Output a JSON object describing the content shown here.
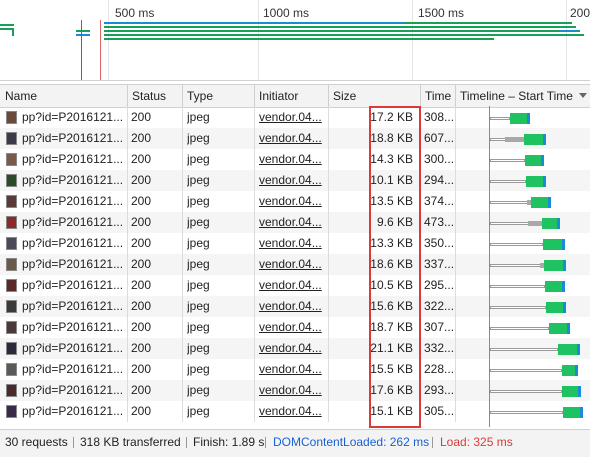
{
  "overview": {
    "ticks": [
      "500 ms",
      "1000 ms",
      "1500 ms",
      "200"
    ],
    "bar_color": "#19a058",
    "accent_blue": "#1a8bd6",
    "marker_blue": "#2f6fd6",
    "marker_red": "#e06666"
  },
  "columns": {
    "name": "Name",
    "status": "Status",
    "type": "Type",
    "initiator": "Initiator",
    "size": "Size",
    "time": "Time",
    "timeline": "Timeline – Start Time",
    "sort_icon": "triangle-down-icon"
  },
  "rows": [
    {
      "name": "pp?id=P2016121...",
      "status": "200",
      "type": "jpeg",
      "initiator": "vendor.04...",
      "size": "17.2 KB",
      "time": "308..."
    },
    {
      "name": "pp?id=P2016121...",
      "status": "200",
      "type": "jpeg",
      "initiator": "vendor.04...",
      "size": "18.8 KB",
      "time": "607..."
    },
    {
      "name": "pp?id=P2016121...",
      "status": "200",
      "type": "jpeg",
      "initiator": "vendor.04...",
      "size": "14.3 KB",
      "time": "300..."
    },
    {
      "name": "pp?id=P2016121...",
      "status": "200",
      "type": "jpeg",
      "initiator": "vendor.04...",
      "size": "10.1 KB",
      "time": "294..."
    },
    {
      "name": "pp?id=P2016121...",
      "status": "200",
      "type": "jpeg",
      "initiator": "vendor.04...",
      "size": "13.5 KB",
      "time": "374..."
    },
    {
      "name": "pp?id=P2016121...",
      "status": "200",
      "type": "jpeg",
      "initiator": "vendor.04...",
      "size": "9.6 KB",
      "time": "473..."
    },
    {
      "name": "pp?id=P2016121...",
      "status": "200",
      "type": "jpeg",
      "initiator": "vendor.04...",
      "size": "13.3 KB",
      "time": "350..."
    },
    {
      "name": "pp?id=P2016121...",
      "status": "200",
      "type": "jpeg",
      "initiator": "vendor.04...",
      "size": "18.6 KB",
      "time": "337..."
    },
    {
      "name": "pp?id=P2016121...",
      "status": "200",
      "type": "jpeg",
      "initiator": "vendor.04...",
      "size": "10.5 KB",
      "time": "295..."
    },
    {
      "name": "pp?id=P2016121...",
      "status": "200",
      "type": "jpeg",
      "initiator": "vendor.04...",
      "size": "15.6 KB",
      "time": "322..."
    },
    {
      "name": "pp?id=P2016121...",
      "status": "200",
      "type": "jpeg",
      "initiator": "vendor.04...",
      "size": "18.7 KB",
      "time": "307..."
    },
    {
      "name": "pp?id=P2016121...",
      "status": "200",
      "type": "jpeg",
      "initiator": "vendor.04...",
      "size": "21.1 KB",
      "time": "332..."
    },
    {
      "name": "pp?id=P2016121...",
      "status": "200",
      "type": "jpeg",
      "initiator": "vendor.04...",
      "size": "15.5 KB",
      "time": "228..."
    },
    {
      "name": "pp?id=P2016121...",
      "status": "200",
      "type": "jpeg",
      "initiator": "vendor.04...",
      "size": "17.6 KB",
      "time": "293..."
    },
    {
      "name": "pp?id=P2016121...",
      "status": "200",
      "type": "jpeg",
      "initiator": "vendor.04...",
      "size": "15.1 KB",
      "time": "305..."
    }
  ],
  "statusbar": {
    "requests": "30 requests",
    "transferred": "318 KB transferred",
    "finish": "Finish: 1.89 s",
    "dom": "DOMContentLoaded: 262 ms",
    "load": "Load: 325 ms",
    "dom_color": "#1a5fd6",
    "load_color": "#d93a3a"
  },
  "highlight_color": "#d93a3a"
}
